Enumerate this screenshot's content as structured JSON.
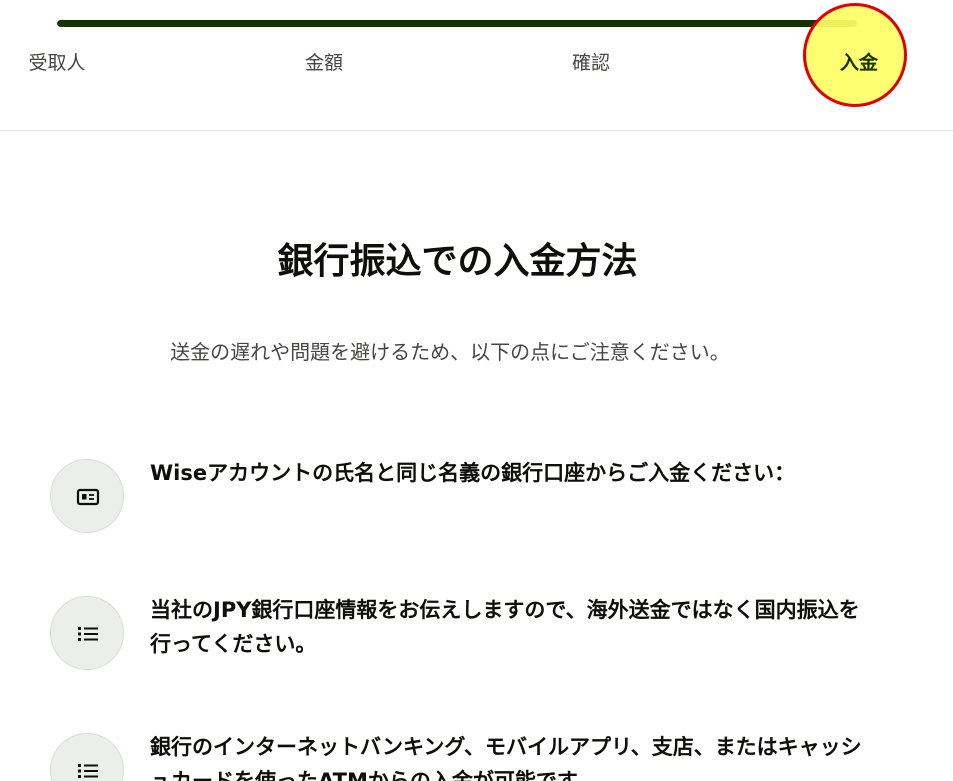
{
  "stepper": {
    "progress": 1.0,
    "steps": [
      {
        "label": "受取人"
      },
      {
        "label": "金額"
      },
      {
        "label": "確認"
      },
      {
        "label": "入金"
      }
    ],
    "active_step": "入金"
  },
  "colors": {
    "progress_fill": "#163300",
    "highlight_fill": "#ffff66",
    "highlight_border": "#e00000",
    "icon_bg": "#eceeeb"
  },
  "main": {
    "title": "銀行振込での入金方法",
    "subtitle": "送金の遅れや問題を避けるため、以下の点にご注意ください。",
    "items": [
      {
        "icon": "id-card-icon",
        "text": "Wiseアカウントの氏名と同じ名義の銀行口座からご入金ください："
      },
      {
        "icon": "list-icon",
        "text": "当社のJPY銀行口座情報をお伝えしますので、海外送金ではなく国内振込を行ってください。"
      },
      {
        "icon": "list-icon",
        "text": "銀行のインターネットバンキング、モバイルアプリ、支店、またはキャッシュカードを使ったATMからの入金が可能です。"
      }
    ]
  }
}
